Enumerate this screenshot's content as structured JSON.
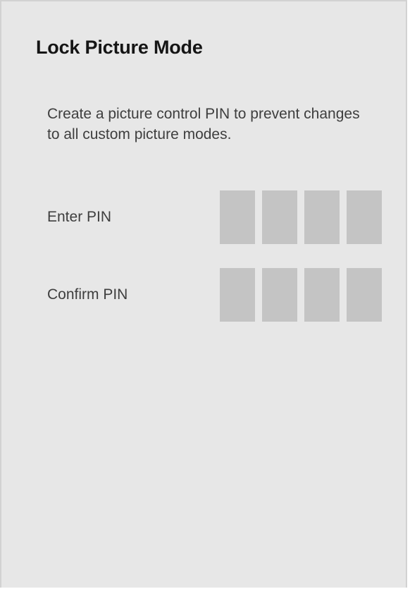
{
  "dialog": {
    "title": "Lock Picture Mode",
    "description": "Create a picture control PIN to prevent changes to all custom picture modes.",
    "enter_pin": {
      "label": "Enter PIN",
      "digits": [
        "",
        "",
        "",
        ""
      ]
    },
    "confirm_pin": {
      "label": "Confirm PIN",
      "digits": [
        "",
        "",
        "",
        ""
      ]
    }
  },
  "colors": {
    "panel_background": "#e7e7e7",
    "pin_box": "#c4c4c4",
    "title_text": "#151515",
    "body_text": "#3e3e3e"
  }
}
